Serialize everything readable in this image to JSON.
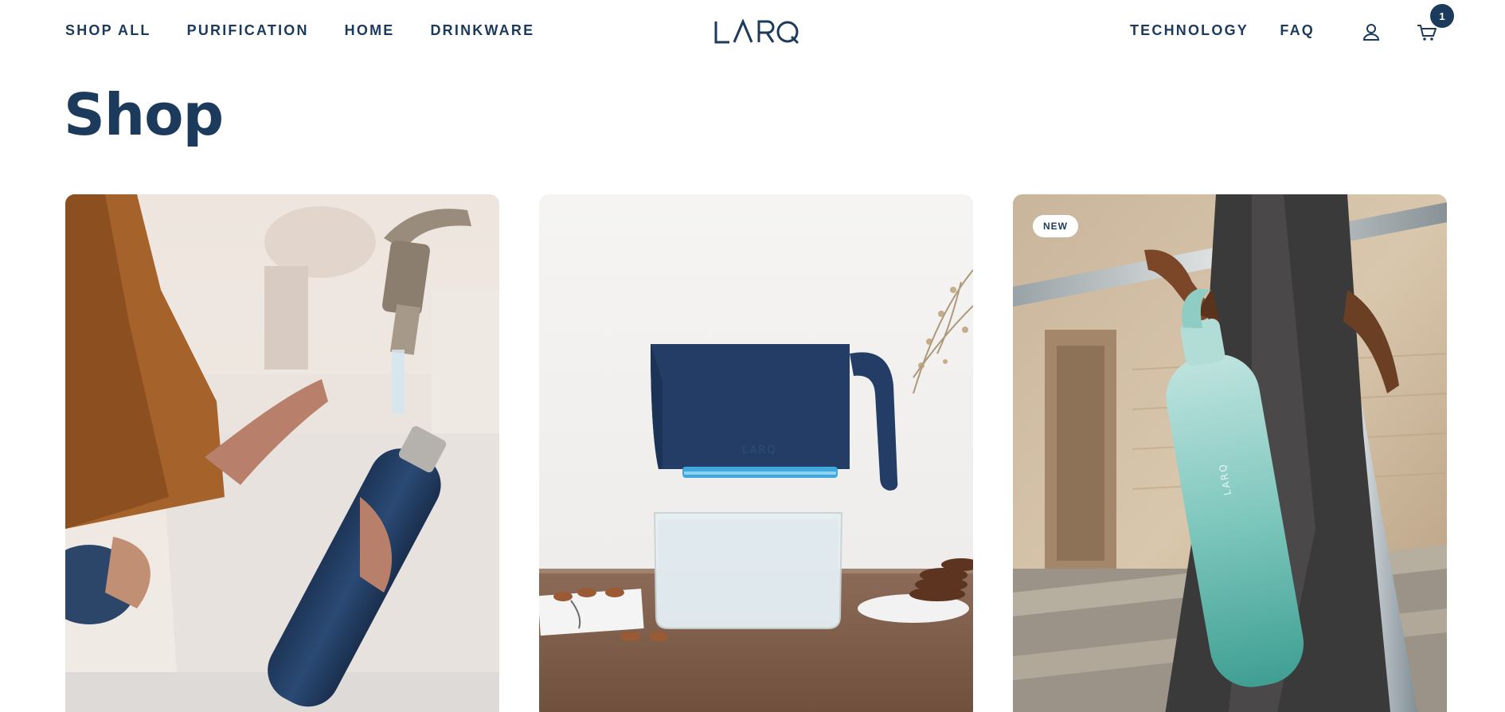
{
  "header": {
    "nav_left": [
      "SHOP ALL",
      "PURIFICATION",
      "HOME",
      "DRINKWARE"
    ],
    "logo_text": "LARQ",
    "nav_right": [
      "TECHNOLOGY",
      "FAQ"
    ],
    "cart_count": "1",
    "icons": [
      "account-icon",
      "cart-icon"
    ]
  },
  "page": {
    "title": "Shop"
  },
  "products": [
    {
      "image": "bottle-filling-under-faucet",
      "badge": ""
    },
    {
      "image": "pitcher-on-table",
      "badge": ""
    },
    {
      "image": "person-carrying-teal-bottle",
      "badge": "NEW"
    }
  ],
  "colors": {
    "brand_navy": "#1b3a5c",
    "badge_bg": "#ffffff"
  }
}
